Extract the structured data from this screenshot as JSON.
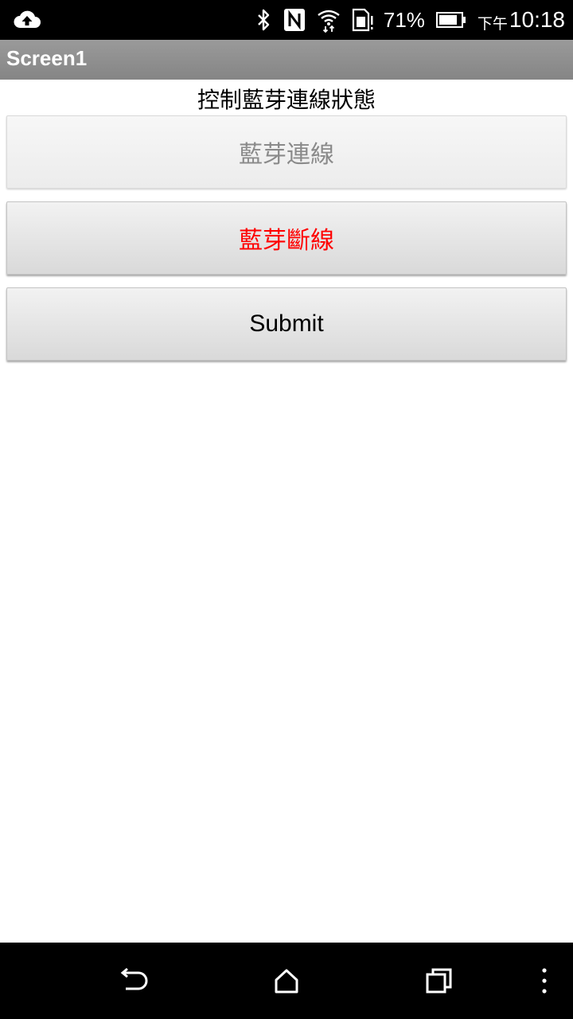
{
  "status_bar": {
    "icons": [
      "upload-cloud-icon",
      "bluetooth-icon",
      "nfc-icon",
      "wifi-icon",
      "sim-icon",
      "battery-icon"
    ],
    "battery_percent": "71%",
    "clock_prefix": "下午",
    "clock": "10:18"
  },
  "app": {
    "title": "Screen1"
  },
  "main": {
    "label": "控制藍芽連線狀態",
    "connect_button": "藍芽連線",
    "disconnect_button": "藍芽斷線",
    "submit_button": "Submit"
  },
  "colors": {
    "connect_text": "#8a8a8a",
    "disconnect_text": "#ff0000",
    "submit_text": "#000000",
    "title_bar": "#8f8f8f"
  },
  "nav_bar": {
    "icons": [
      "back-icon",
      "home-icon",
      "recents-icon",
      "overflow-menu-icon"
    ]
  }
}
